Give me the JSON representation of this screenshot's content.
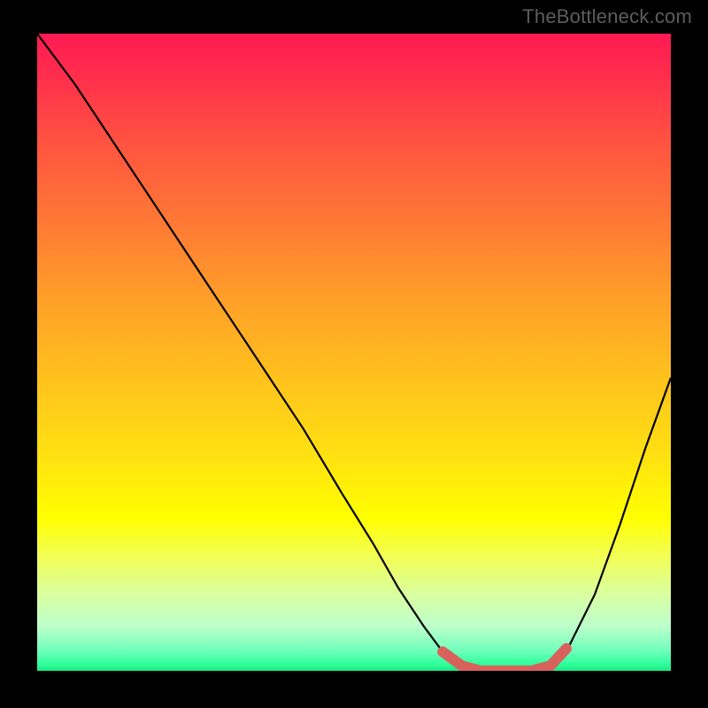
{
  "watermark": "TheBottleneck.com",
  "chart_data": {
    "type": "line",
    "title": "",
    "xlabel": "",
    "ylabel": "",
    "xlim": [
      0,
      1
    ],
    "ylim": [
      0,
      1
    ],
    "grid": false,
    "curve": [
      {
        "x": 0.0,
        "y": 0.0
      },
      {
        "x": 0.06,
        "y": 0.08
      },
      {
        "x": 0.12,
        "y": 0.17
      },
      {
        "x": 0.18,
        "y": 0.26
      },
      {
        "x": 0.24,
        "y": 0.35
      },
      {
        "x": 0.3,
        "y": 0.44
      },
      {
        "x": 0.36,
        "y": 0.53
      },
      {
        "x": 0.42,
        "y": 0.62
      },
      {
        "x": 0.48,
        "y": 0.72
      },
      {
        "x": 0.53,
        "y": 0.8
      },
      {
        "x": 0.57,
        "y": 0.87
      },
      {
        "x": 0.61,
        "y": 0.93
      },
      {
        "x": 0.64,
        "y": 0.97
      },
      {
        "x": 0.67,
        "y": 0.992
      },
      {
        "x": 0.7,
        "y": 1.0
      },
      {
        "x": 0.74,
        "y": 1.0
      },
      {
        "x": 0.78,
        "y": 1.0
      },
      {
        "x": 0.81,
        "y": 0.992
      },
      {
        "x": 0.84,
        "y": 0.96
      },
      {
        "x": 0.88,
        "y": 0.88
      },
      {
        "x": 0.92,
        "y": 0.77
      },
      {
        "x": 0.96,
        "y": 0.65
      },
      {
        "x": 1.0,
        "y": 0.54
      }
    ],
    "accent_segment": [
      {
        "x": 0.64,
        "y": 0.97
      },
      {
        "x": 0.67,
        "y": 0.992
      },
      {
        "x": 0.7,
        "y": 1.0
      },
      {
        "x": 0.74,
        "y": 1.0
      },
      {
        "x": 0.78,
        "y": 1.0
      },
      {
        "x": 0.81,
        "y": 0.992
      },
      {
        "x": 0.835,
        "y": 0.965
      }
    ],
    "gradient_stops": [
      {
        "pos": 0.0,
        "color": "#ff1a52"
      },
      {
        "pos": 0.3,
        "color": "#ff7a34"
      },
      {
        "pos": 0.6,
        "color": "#ffe012"
      },
      {
        "pos": 0.82,
        "color": "#f3ff55"
      },
      {
        "pos": 1.0,
        "color": "#19e882"
      }
    ]
  }
}
